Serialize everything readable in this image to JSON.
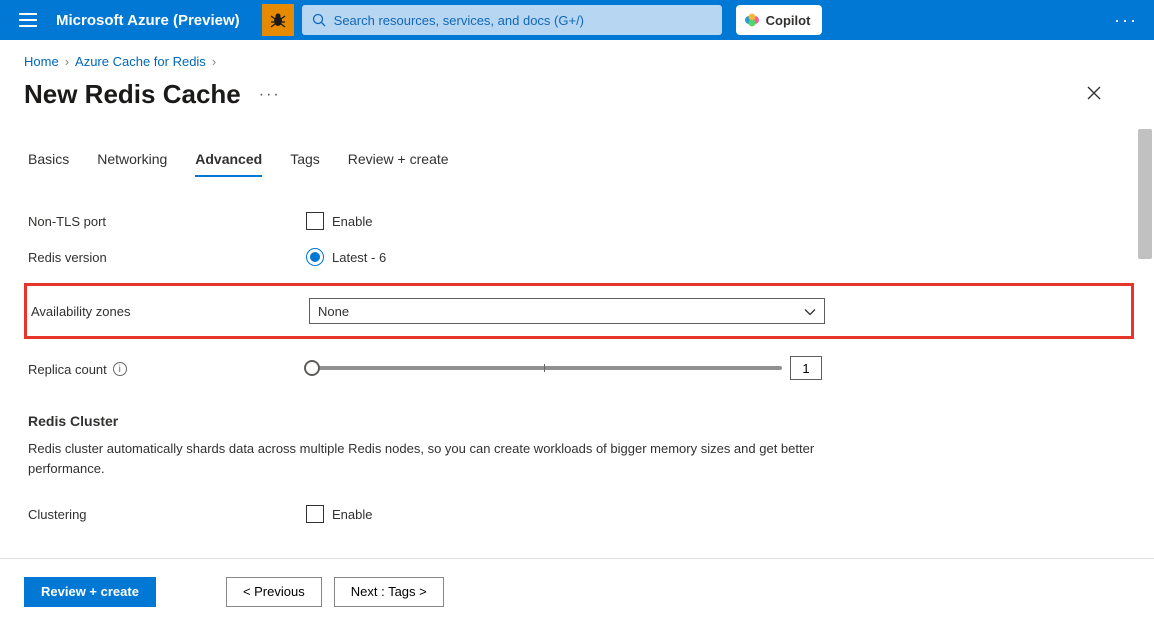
{
  "topbar": {
    "brand": "Microsoft Azure (Preview)",
    "search_placeholder": "Search resources, services, and docs (G+/)",
    "copilot_label": "Copilot"
  },
  "breadcrumb": {
    "home": "Home",
    "redis": "Azure Cache for Redis"
  },
  "page_title": "New Redis Cache",
  "tabs": {
    "basics": "Basics",
    "networking": "Networking",
    "advanced": "Advanced",
    "tags": "Tags",
    "review": "Review + create"
  },
  "form": {
    "non_tls_label": "Non-TLS port",
    "enable_label": "Enable",
    "redis_version_label": "Redis version",
    "redis_version_value": "Latest - 6",
    "availability_zones_label": "Availability zones",
    "availability_zones_value": "None",
    "replica_count_label": "Replica count",
    "replica_count_value": "1",
    "cluster_heading": "Redis Cluster",
    "cluster_desc": "Redis cluster automatically shards data across multiple Redis nodes, so you can create workloads of bigger memory sizes and get better performance.",
    "clustering_label": "Clustering"
  },
  "footer": {
    "review_create": "Review + create",
    "previous": "< Previous",
    "next": "Next : Tags >"
  }
}
